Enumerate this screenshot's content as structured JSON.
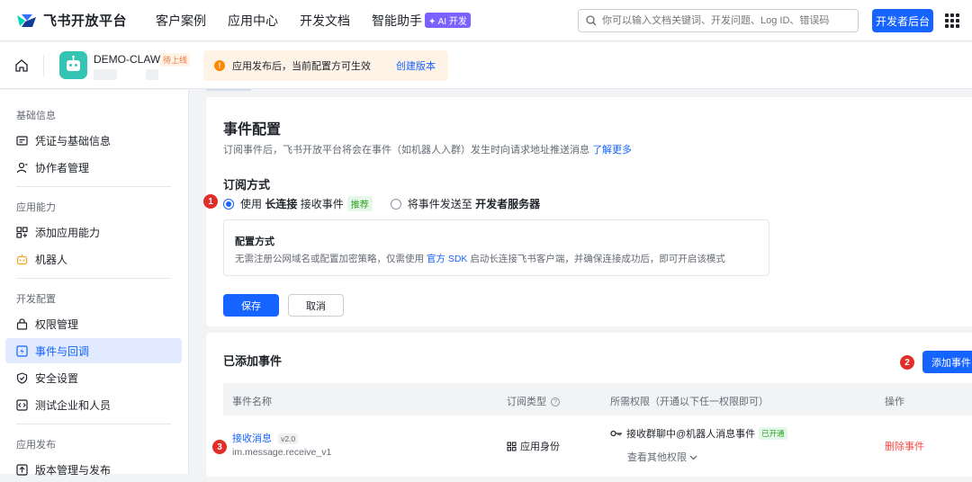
{
  "topnav": {
    "logo_text": "飞书开放平台",
    "links": [
      "客户案例",
      "应用中心",
      "开发文档",
      "智能助手"
    ],
    "ai_badge": "✦ AI 开发",
    "search_placeholder": "你可以输入文档关键词、开发问题、Log ID、错误码",
    "dev_button": "开发者后台"
  },
  "app": {
    "name": "DEMO-CLAW",
    "status": "待上线",
    "notice": "应用发布后，当前配置方可生效",
    "notice_link": "创建版本"
  },
  "sidebar": {
    "groups": [
      {
        "title": "基础信息",
        "items": [
          "凭证与基础信息",
          "协作者管理"
        ]
      },
      {
        "title": "应用能力",
        "items": [
          "添加应用能力",
          "机器人"
        ]
      },
      {
        "title": "开发配置",
        "items": [
          "权限管理",
          "事件与回调",
          "安全设置",
          "测试企业和人员"
        ]
      },
      {
        "title": "应用发布",
        "items": [
          "版本管理与发布"
        ]
      }
    ],
    "active_item": "事件与回调"
  },
  "event_config": {
    "title": "事件配置",
    "desc": "订阅事件后，飞书开放平台将会在事件（如机器人入群）发生时向请求地址推送消息",
    "learn_more": "了解更多",
    "sub_title": "订阅方式",
    "option1_pre": "使用",
    "option1_bold": "长连接",
    "option1_post": "接收事件",
    "option1_tag": "推荐",
    "option2_pre": "将事件发送至",
    "option2_bold": "开发者服务器",
    "config_title": "配置方式",
    "config_desc_pre": "无需注册公网域名或配置加密策略，仅需使用",
    "config_desc_link": "官方 SDK",
    "config_desc_post": "启动长连接飞书客户端，并确保连接成功后，即可开启该模式",
    "save": "保存",
    "cancel": "取消"
  },
  "events": {
    "title": "已添加事件",
    "add_button": "添加事件",
    "columns": [
      "事件名称",
      "订阅类型",
      "所需权限（开通以下任一权限即可）",
      "操作"
    ],
    "rows": [
      {
        "name": "接收消息",
        "version": "v2.0",
        "code": "im.message.receive_v1",
        "type": "应用身份",
        "permission": "接收群聊中@机器人消息事件",
        "permission_status": "已开通",
        "more_permissions": "查看其他权限",
        "action": "删除事件"
      }
    ]
  },
  "markers": [
    "1",
    "2",
    "3"
  ],
  "colors": {
    "accent": "#1664ff",
    "danger": "#f54a45",
    "marker": "#e22e28",
    "warning": "#ff8800",
    "success": "#2ea121"
  }
}
